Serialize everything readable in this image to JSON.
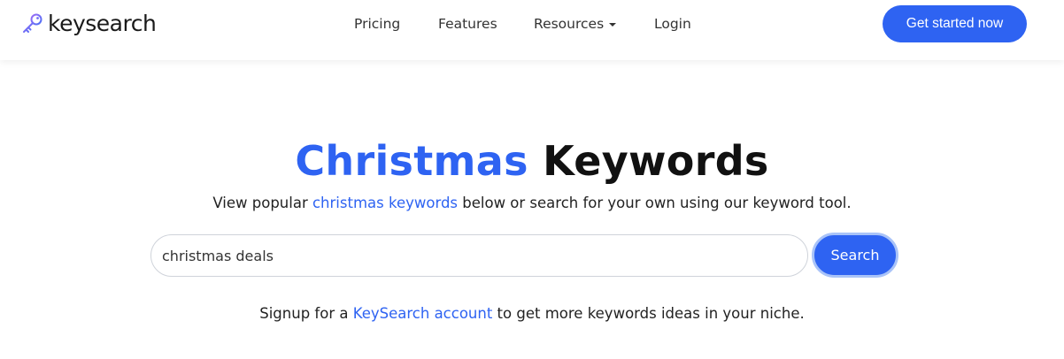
{
  "brand": {
    "name": "keysearch",
    "logo_icon": "key-icon",
    "logo_color": "#7a5af8"
  },
  "nav": {
    "pricing": "Pricing",
    "features": "Features",
    "resources": "Resources",
    "login": "Login",
    "cta": "Get started now"
  },
  "hero": {
    "title_accent": "Christmas",
    "title_rest": "Keywords",
    "subtitle_prefix": "View popular ",
    "subtitle_link": "christmas keywords",
    "subtitle_suffix": " below or search for your own using our keyword tool."
  },
  "search": {
    "value": "christmas deals",
    "button": "Search"
  },
  "signup": {
    "prefix": "Signup for a ",
    "link": "KeySearch account",
    "suffix": " to get more keywords ideas in your niche."
  },
  "colors": {
    "accent": "#2e63f2",
    "text": "#111111"
  }
}
